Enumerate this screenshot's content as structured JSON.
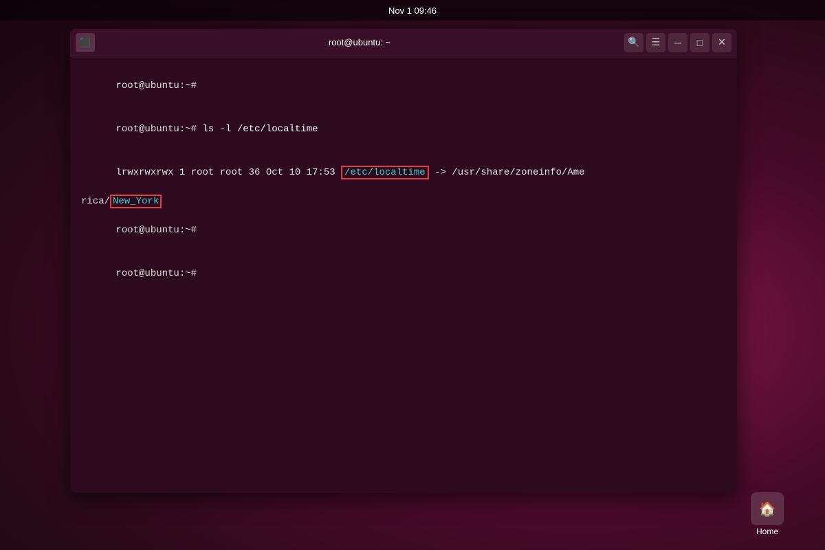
{
  "taskbar": {
    "datetime": "Nov 1  09:46"
  },
  "terminal": {
    "title": "root@ubuntu: ~",
    "title_icon": "⬛",
    "lines": {
      "line1": "root@ubuntu:~#",
      "line2_prompt": "root@ubuntu:~# ",
      "line2_cmd": "ls -l /etc/localtime",
      "line3_perms": "lrwxrwxrwx 1 root root 36 Oct 10 17:53 ",
      "line3_localtime": "/etc/localtime",
      "line3_arrow": " -> /usr/share/zoneinfo/Ame",
      "line3_cont_prefix": "rica/",
      "line3_newyork": "New_York",
      "line4_prompt": "root@ubuntu:~#",
      "line5_prompt": "root@ubuntu:~#"
    },
    "buttons": {
      "search": "🔍",
      "menu": "☰",
      "minimize": "─",
      "maximize": "□",
      "close": "✕"
    }
  },
  "dock": {
    "home_label": "Home"
  }
}
